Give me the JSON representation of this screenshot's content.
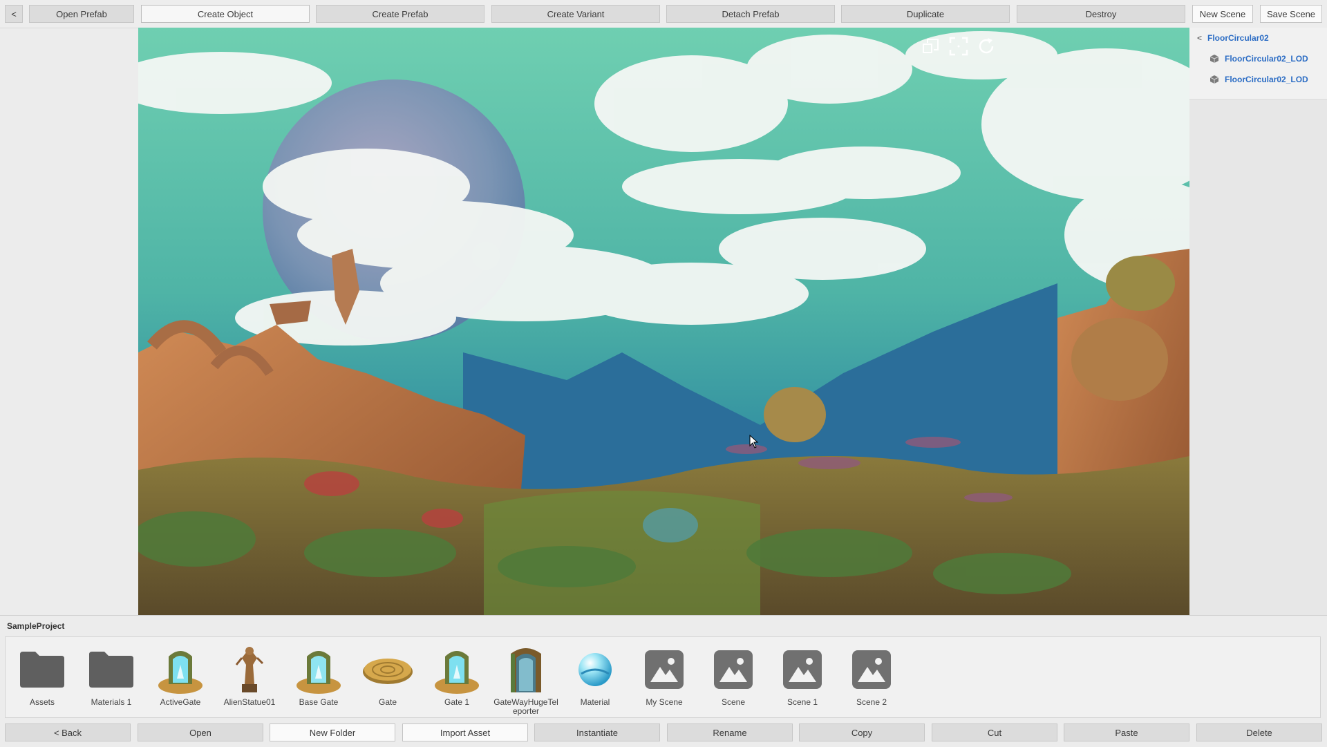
{
  "toolbar": {
    "back": "<",
    "open_prefab": "Open Prefab",
    "create_object": "Create Object",
    "create_prefab": "Create Prefab",
    "create_variant": "Create Variant",
    "detach_prefab": "Detach Prefab",
    "duplicate": "Duplicate",
    "destroy": "Destroy",
    "new_scene": "New Scene",
    "save_scene": "Save Scene"
  },
  "viewport": {
    "controls": [
      "resize-icon",
      "fullscreen-icon",
      "refresh-icon"
    ]
  },
  "hierarchy": {
    "back": "<",
    "root": "FloorCircular02",
    "children": [
      "FloorCircular02_LOD",
      "FloorCircular02_LOD"
    ]
  },
  "project": {
    "title": "SampleProject",
    "assets": [
      {
        "label": "Assets",
        "icon": "folder-icon"
      },
      {
        "label": "Materials 1",
        "icon": "folder-icon"
      },
      {
        "label": "ActiveGate",
        "icon": "gate-icon"
      },
      {
        "label": "AlienStatue01",
        "icon": "statue-icon"
      },
      {
        "label": "Base Gate",
        "icon": "gate-icon"
      },
      {
        "label": "Gate",
        "icon": "platform-icon"
      },
      {
        "label": "Gate 1",
        "icon": "gate-icon"
      },
      {
        "label": "GateWayHugeTeleporter",
        "icon": "teleporter-icon"
      },
      {
        "label": "Material",
        "icon": "material-sphere-icon"
      },
      {
        "label": "My Scene",
        "icon": "scene-icon"
      },
      {
        "label": "Scene",
        "icon": "scene-icon"
      },
      {
        "label": "Scene 1",
        "icon": "scene-icon"
      },
      {
        "label": "Scene 2",
        "icon": "scene-icon"
      }
    ],
    "actions": {
      "back": "< Back",
      "open": "Open",
      "new_folder": "New Folder",
      "import_asset": "Import Asset",
      "instantiate": "Instantiate",
      "rename": "Rename",
      "copy": "Copy",
      "cut": "Cut",
      "paste": "Paste",
      "delete": "Delete"
    }
  },
  "colors": {
    "link": "#2b6cc4",
    "button_bg": "#dcdcdc",
    "panel_bg": "#ececec"
  }
}
